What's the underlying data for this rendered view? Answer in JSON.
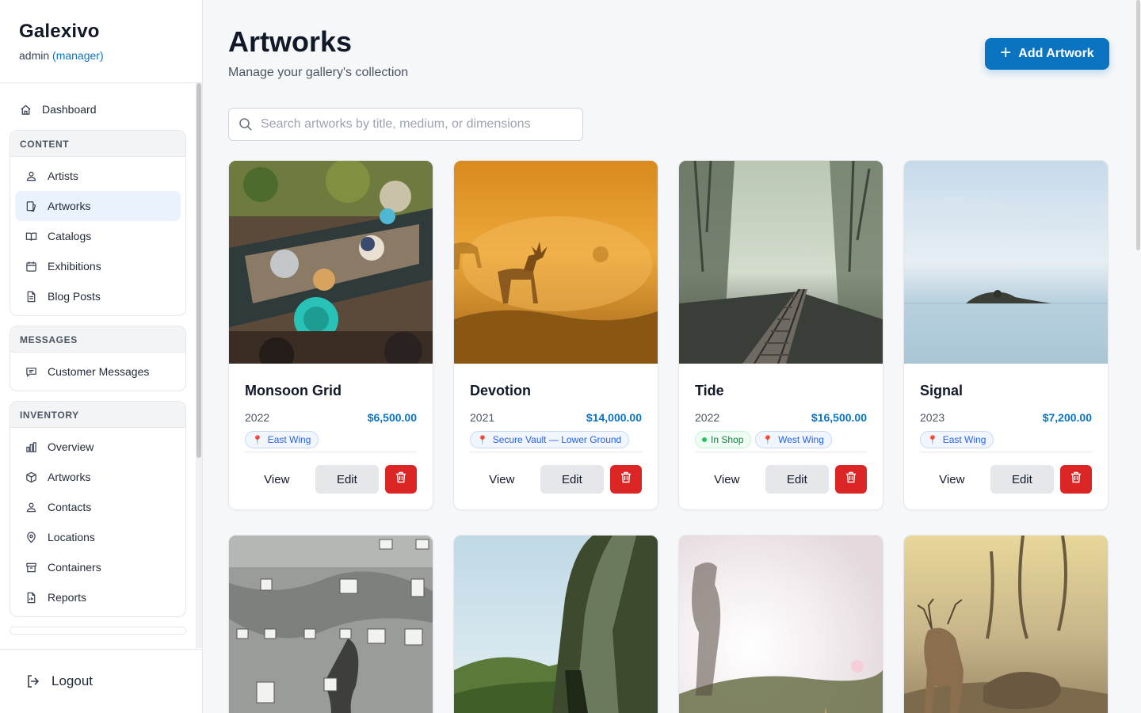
{
  "brand": {
    "name": "Galexivo",
    "user": "admin",
    "role": "(manager)"
  },
  "nav": {
    "dashboard": "Dashboard",
    "groups": [
      {
        "header": "CONTENT",
        "items": [
          {
            "label": "Artists",
            "icon": "artists-icon"
          },
          {
            "label": "Artworks",
            "icon": "artworks-icon",
            "active": true
          },
          {
            "label": "Catalogs",
            "icon": "catalogs-icon"
          },
          {
            "label": "Exhibitions",
            "icon": "exhibitions-icon"
          },
          {
            "label": "Blog Posts",
            "icon": "blog-posts-icon"
          }
        ]
      },
      {
        "header": "MESSAGES",
        "items": [
          {
            "label": "Customer Messages",
            "icon": "messages-icon"
          }
        ]
      },
      {
        "header": "INVENTORY",
        "items": [
          {
            "label": "Overview",
            "icon": "overview-icon"
          },
          {
            "label": "Artworks",
            "icon": "box-icon"
          },
          {
            "label": "Contacts",
            "icon": "contacts-icon"
          },
          {
            "label": "Locations",
            "icon": "locations-icon"
          },
          {
            "label": "Containers",
            "icon": "containers-icon"
          },
          {
            "label": "Reports",
            "icon": "reports-icon"
          }
        ]
      }
    ],
    "logout": "Logout"
  },
  "header": {
    "title": "Artworks",
    "subtitle": "Manage your gallery's collection",
    "add_button": "Add Artwork"
  },
  "search": {
    "placeholder": "Search artworks by title, medium, or dimensions",
    "value": ""
  },
  "card_actions": {
    "view": "View",
    "edit": "Edit"
  },
  "artworks": [
    {
      "title": "Monsoon Grid",
      "year": "2022",
      "price": "$6,500.00",
      "tags": [
        {
          "type": "location",
          "label": "East Wing"
        }
      ],
      "image": "floating-market-photo"
    },
    {
      "title": "Devotion",
      "year": "2021",
      "price": "$14,000.00",
      "tags": [
        {
          "type": "location",
          "label": "Secure Vault — Lower Ground"
        }
      ],
      "image": "deer-in-orange-fog-photo"
    },
    {
      "title": "Tide",
      "year": "2022",
      "price": "$16,500.00",
      "tags": [
        {
          "type": "shop",
          "label": "In Shop"
        },
        {
          "type": "location",
          "label": "West Wing"
        }
      ],
      "image": "misty-railway-photo"
    },
    {
      "title": "Signal",
      "year": "2023",
      "price": "$7,200.00",
      "tags": [
        {
          "type": "location",
          "label": "East Wing"
        }
      ],
      "image": "island-seascape-photo"
    },
    {
      "image": "weathered-building-photo"
    },
    {
      "image": "cliff-landscape-photo"
    },
    {
      "image": "sunlit-figure-photo"
    },
    {
      "image": "stag-in-forest-photo"
    }
  ],
  "colors": {
    "accent": "#0b74c2",
    "danger": "#dc2626",
    "active_nav": "#eaf3fd"
  }
}
